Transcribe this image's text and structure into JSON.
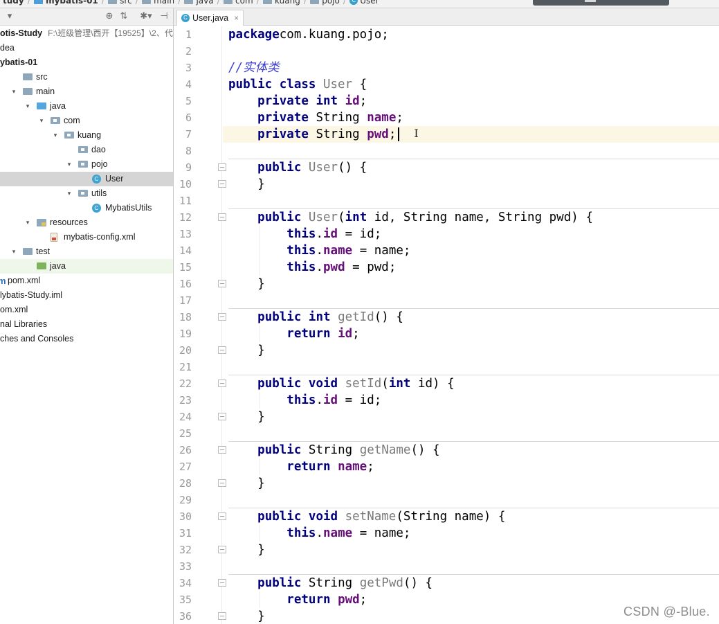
{
  "breadcrumb": [
    {
      "label": "tudy",
      "icon": "none",
      "bold": true
    },
    {
      "label": "mybatis-01",
      "icon": "module-icon",
      "bold": true
    },
    {
      "label": "src",
      "icon": "folder-icon",
      "bold": false
    },
    {
      "label": "main",
      "icon": "folder-icon",
      "bold": false
    },
    {
      "label": "java",
      "icon": "folder-icon",
      "bold": false
    },
    {
      "label": "com",
      "icon": "folder-icon",
      "bold": false
    },
    {
      "label": "kuang",
      "icon": "folder-icon",
      "bold": false
    },
    {
      "label": "pojo",
      "icon": "folder-icon",
      "bold": false
    },
    {
      "label": "User",
      "icon": "class-icon",
      "bold": false
    }
  ],
  "panel_toolbar": {
    "dropdown_icon": "▾",
    "globe_icon": "⊕",
    "collapse_icon": "⇅",
    "settings_icon": "✱▾",
    "hide_icon": "⊣"
  },
  "project_tree": [
    {
      "label": "otis-Study",
      "sub": "F:\\班级管理\\西开【19525】\\2、代",
      "indent": 0,
      "arrow": "",
      "icon": "none",
      "bold": true,
      "state": ""
    },
    {
      "label": "dea",
      "indent": 0,
      "arrow": "",
      "icon": "none",
      "bold": false,
      "state": ""
    },
    {
      "label": "ybatis-01",
      "indent": 0,
      "arrow": "",
      "icon": "none",
      "bold": true,
      "state": ""
    },
    {
      "label": "src",
      "indent": 1,
      "arrow": "",
      "icon": "folder",
      "bold": false,
      "state": ""
    },
    {
      "label": "main",
      "indent": 1,
      "arrow": "▾",
      "icon": "folder",
      "bold": false,
      "state": ""
    },
    {
      "label": "java",
      "indent": 2,
      "arrow": "▾",
      "icon": "folder-blue",
      "bold": false,
      "state": ""
    },
    {
      "label": "com",
      "indent": 3,
      "arrow": "▾",
      "icon": "package",
      "bold": false,
      "state": ""
    },
    {
      "label": "kuang",
      "indent": 4,
      "arrow": "▾",
      "icon": "package",
      "bold": false,
      "state": ""
    },
    {
      "label": "dao",
      "indent": 5,
      "arrow": "",
      "icon": "package",
      "bold": false,
      "state": ""
    },
    {
      "label": "pojo",
      "indent": 5,
      "arrow": "▾",
      "icon": "package",
      "bold": false,
      "state": ""
    },
    {
      "label": "User",
      "indent": 6,
      "arrow": "",
      "icon": "class",
      "bold": false,
      "state": "selected"
    },
    {
      "label": "utils",
      "indent": 5,
      "arrow": "▾",
      "icon": "package",
      "bold": false,
      "state": ""
    },
    {
      "label": "MybatisUtils",
      "indent": 6,
      "arrow": "",
      "icon": "class",
      "bold": false,
      "state": ""
    },
    {
      "label": "resources",
      "indent": 2,
      "arrow": "▾",
      "icon": "resources",
      "bold": false,
      "state": ""
    },
    {
      "label": "mybatis-config.xml",
      "indent": 3,
      "arrow": "",
      "icon": "xml",
      "bold": false,
      "state": ""
    },
    {
      "label": "test",
      "indent": 1,
      "arrow": "▾",
      "icon": "folder",
      "bold": false,
      "state": ""
    },
    {
      "label": "java",
      "indent": 2,
      "arrow": "",
      "icon": "folder-green",
      "bold": false,
      "state": "green"
    },
    {
      "label": "pom.xml",
      "indent": 0,
      "arrow": "",
      "icon": "maven",
      "bold": false,
      "state": ""
    },
    {
      "label": "lybatis-Study.iml",
      "indent": 0,
      "arrow": "",
      "icon": "none",
      "bold": false,
      "state": ""
    },
    {
      "label": "om.xml",
      "indent": 0,
      "arrow": "",
      "icon": "none",
      "bold": false,
      "state": ""
    },
    {
      "label": "nal Libraries",
      "indent": 0,
      "arrow": "",
      "icon": "none",
      "bold": false,
      "state": ""
    },
    {
      "label": "ches and Consoles",
      "indent": 0,
      "arrow": "",
      "icon": "none",
      "bold": false,
      "state": ""
    }
  ],
  "editor": {
    "tab": {
      "label": "User.java",
      "close": "×",
      "icon_letter": "C"
    },
    "current_line": 7,
    "lines": [
      [
        [
          "kw",
          "package"
        ],
        [
          "",
          "com.kuang.pojo;"
        ]
      ],
      [],
      [
        [
          "cmt",
          "//实体类"
        ]
      ],
      [
        [
          "kw",
          "public class "
        ],
        [
          "mth",
          "User"
        ],
        [
          "",
          " {"
        ]
      ],
      [
        [
          "",
          "    "
        ],
        [
          "kw",
          "private int "
        ],
        [
          "fld",
          "id"
        ],
        [
          "",
          ";"
        ]
      ],
      [
        [
          "",
          "    "
        ],
        [
          "kw",
          "private "
        ],
        [
          "",
          "String "
        ],
        [
          "fld",
          "name"
        ],
        [
          "",
          ";"
        ]
      ],
      [
        [
          "",
          "    "
        ],
        [
          "kw",
          "private "
        ],
        [
          "",
          "String "
        ],
        [
          "fld",
          "pwd"
        ],
        [
          "",
          ";"
        ]
      ],
      [],
      [
        [
          "",
          "    "
        ],
        [
          "kw",
          "public "
        ],
        [
          "mth",
          "User"
        ],
        [
          "",
          "() {"
        ]
      ],
      [
        [
          "",
          "    }"
        ]
      ],
      [],
      [
        [
          "",
          "    "
        ],
        [
          "kw",
          "public "
        ],
        [
          "mth",
          "User"
        ],
        [
          "",
          "("
        ],
        [
          "kw",
          "int "
        ],
        [
          "",
          "id, String name, String pwd) {"
        ]
      ],
      [
        [
          "",
          "        "
        ],
        [
          "kw",
          "this"
        ],
        [
          "",
          "."
        ],
        [
          "fld",
          "id"
        ],
        [
          "",
          " = id;"
        ]
      ],
      [
        [
          "",
          "        "
        ],
        [
          "kw",
          "this"
        ],
        [
          "",
          "."
        ],
        [
          "fld",
          "name"
        ],
        [
          "",
          " = name;"
        ]
      ],
      [
        [
          "",
          "        "
        ],
        [
          "kw",
          "this"
        ],
        [
          "",
          "."
        ],
        [
          "fld",
          "pwd"
        ],
        [
          "",
          " = pwd;"
        ]
      ],
      [
        [
          "",
          "    }"
        ]
      ],
      [],
      [
        [
          "",
          "    "
        ],
        [
          "kw",
          "public int "
        ],
        [
          "mth",
          "getId"
        ],
        [
          "",
          "() {"
        ]
      ],
      [
        [
          "",
          "        "
        ],
        [
          "kw",
          "return "
        ],
        [
          "fld",
          "id"
        ],
        [
          "",
          ";"
        ]
      ],
      [
        [
          "",
          "    }"
        ]
      ],
      [],
      [
        [
          "",
          "    "
        ],
        [
          "kw",
          "public void "
        ],
        [
          "mth",
          "setId"
        ],
        [
          "",
          "("
        ],
        [
          "kw",
          "int "
        ],
        [
          "",
          "id) {"
        ]
      ],
      [
        [
          "",
          "        "
        ],
        [
          "kw",
          "this"
        ],
        [
          "",
          "."
        ],
        [
          "fld",
          "id"
        ],
        [
          "",
          " = id;"
        ]
      ],
      [
        [
          "",
          "    }"
        ]
      ],
      [],
      [
        [
          "",
          "    "
        ],
        [
          "kw",
          "public "
        ],
        [
          "",
          "String "
        ],
        [
          "mth",
          "getName"
        ],
        [
          "",
          "() {"
        ]
      ],
      [
        [
          "",
          "        "
        ],
        [
          "kw",
          "return "
        ],
        [
          "fld",
          "name"
        ],
        [
          "",
          ";"
        ]
      ],
      [
        [
          "",
          "    }"
        ]
      ],
      [],
      [
        [
          "",
          "    "
        ],
        [
          "kw",
          "public void "
        ],
        [
          "mth",
          "setName"
        ],
        [
          "",
          "(String name) {"
        ]
      ],
      [
        [
          "",
          "        "
        ],
        [
          "kw",
          "this"
        ],
        [
          "",
          "."
        ],
        [
          "fld",
          "name"
        ],
        [
          "",
          " = name;"
        ]
      ],
      [
        [
          "",
          "    }"
        ]
      ],
      [],
      [
        [
          "",
          "    "
        ],
        [
          "kw",
          "public "
        ],
        [
          "",
          "String "
        ],
        [
          "mth",
          "getPwd"
        ],
        [
          "",
          "() {"
        ]
      ],
      [
        [
          "",
          "        "
        ],
        [
          "kw",
          "return "
        ],
        [
          "fld",
          "pwd"
        ],
        [
          "",
          ";"
        ]
      ],
      [
        [
          "",
          "    }"
        ]
      ]
    ],
    "fold_lines": [
      9,
      10,
      12,
      16,
      18,
      20,
      22,
      24,
      26,
      28,
      30,
      32,
      34,
      36
    ],
    "separator_after_lines": [
      8,
      11,
      17,
      21,
      25,
      29,
      33
    ]
  },
  "watermark": "CSDN @-Blue.",
  "colors": {
    "keyword": "#000080",
    "field": "#660e7a",
    "method_decl": "#7a7a7a",
    "comment": "#3d3dcf",
    "current_line": "#fcf7e4",
    "selected_row": "#d5d5d5"
  }
}
